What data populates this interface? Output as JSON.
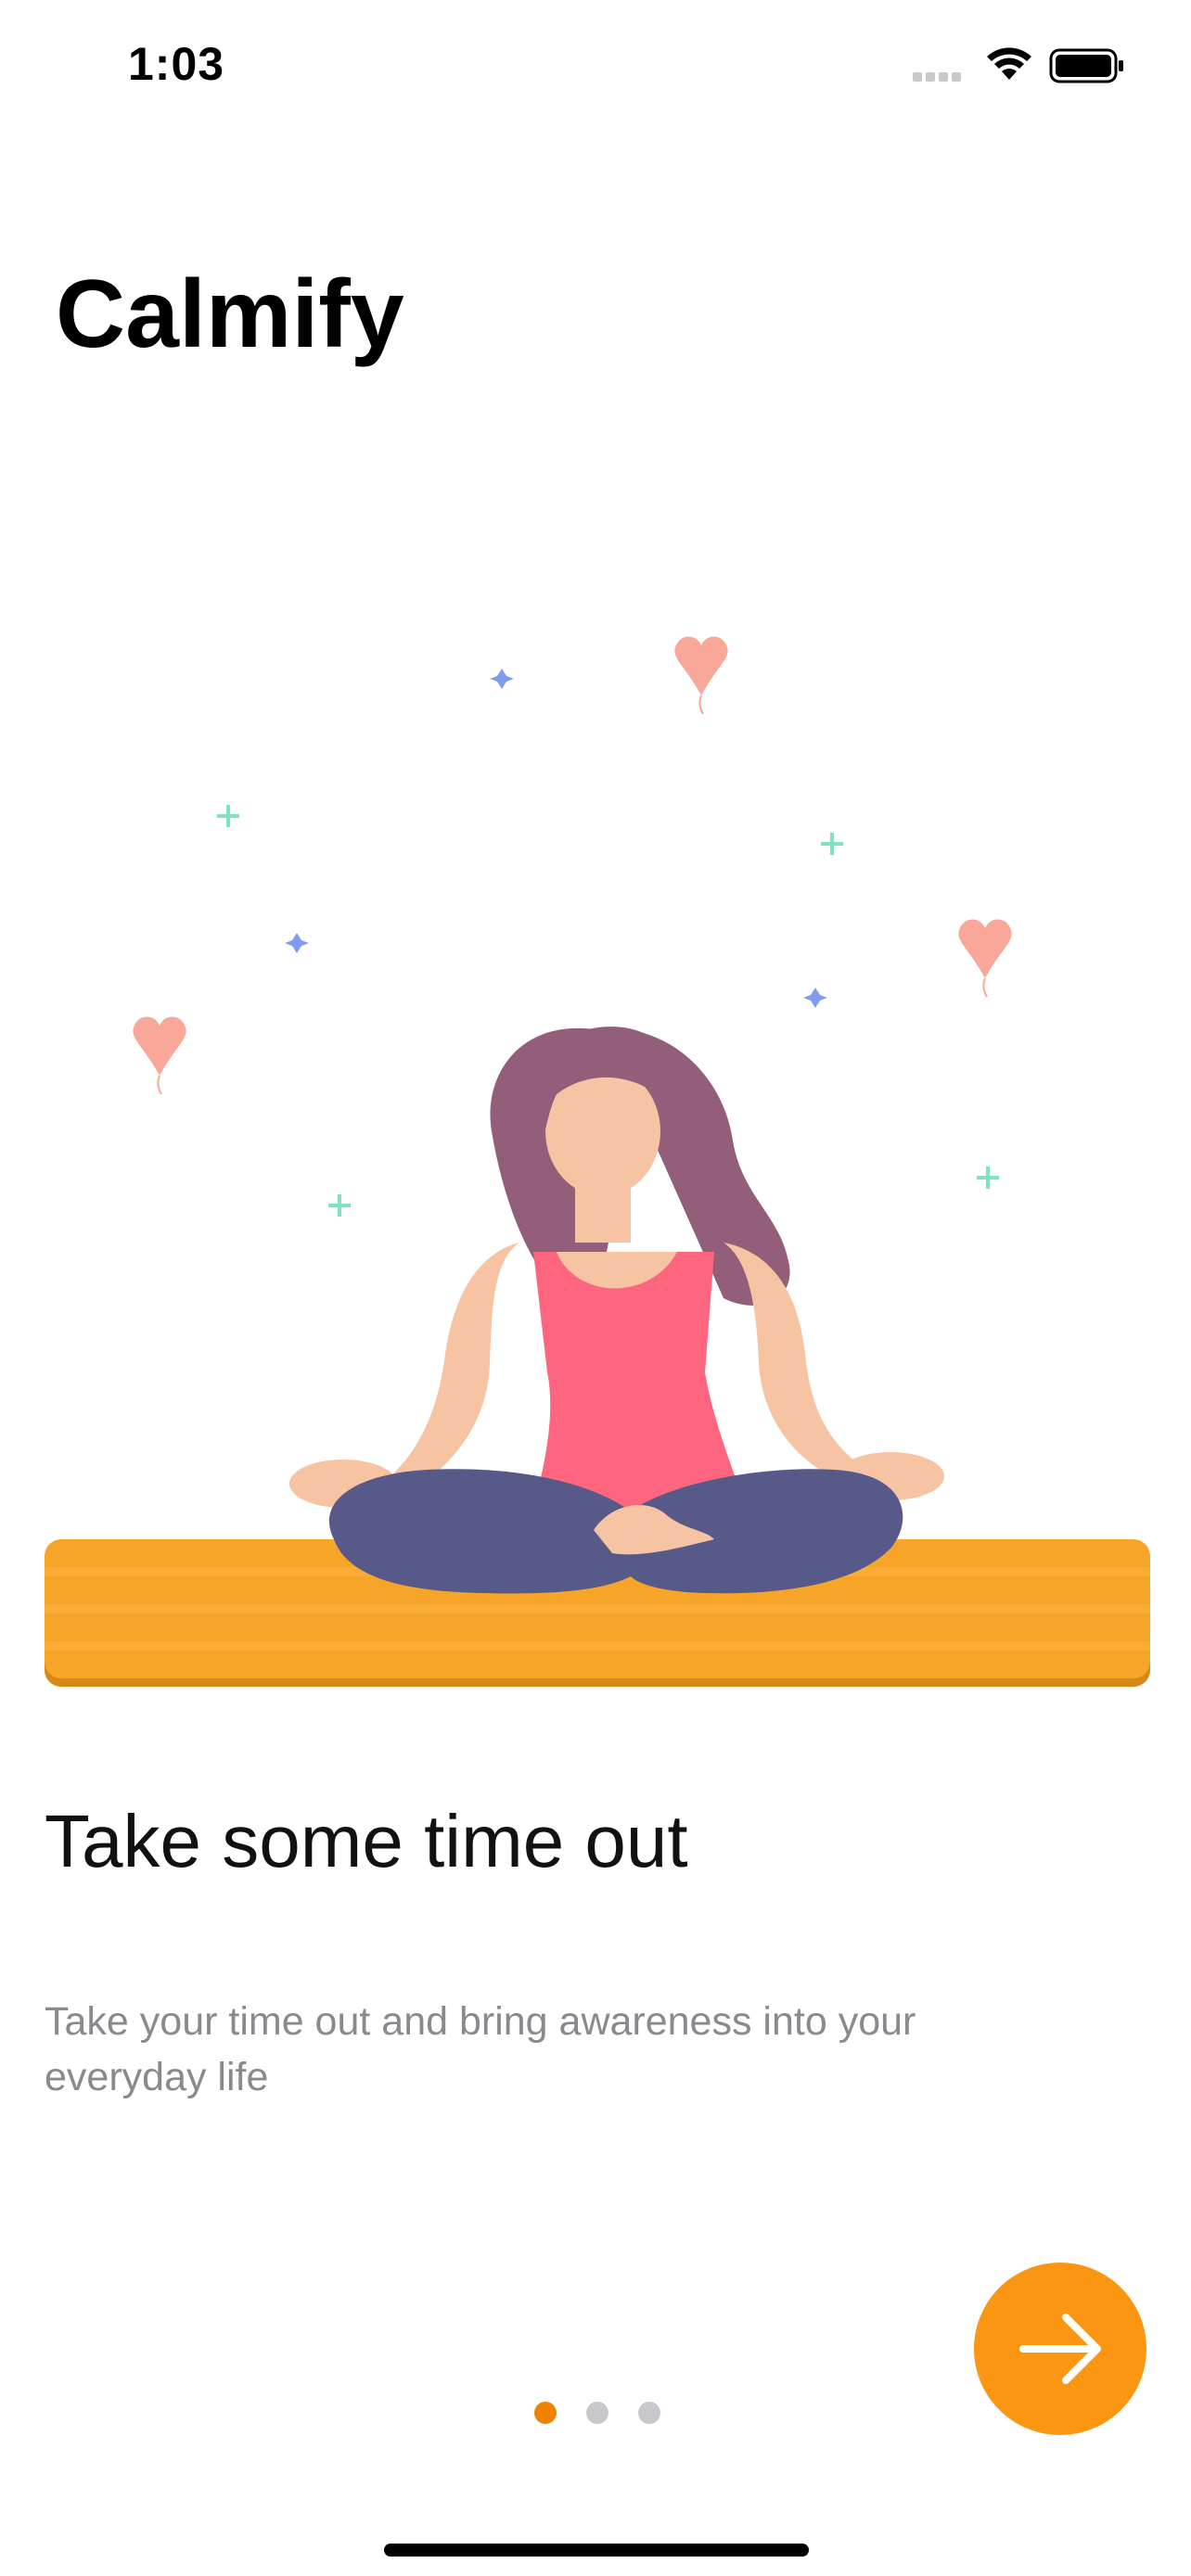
{
  "status_bar": {
    "time": "1:03"
  },
  "app": {
    "title": "Calmify"
  },
  "onboarding": {
    "title": "Take some time out",
    "description": "Take your time out and bring awareness into your everyday life",
    "page_count": 3,
    "current_page": 1
  },
  "next_button": {
    "icon": "arrow-right-icon"
  },
  "colors": {
    "accent": "#fb9613",
    "active_dot": "#f08200",
    "inactive_dot": "#c7c7cc",
    "description_text": "#8a8a8e",
    "mat": "#f7a528",
    "pants": "#575a89",
    "top": "#fe6680",
    "hair": "#935e7a",
    "skin": "#f6c3a3"
  }
}
